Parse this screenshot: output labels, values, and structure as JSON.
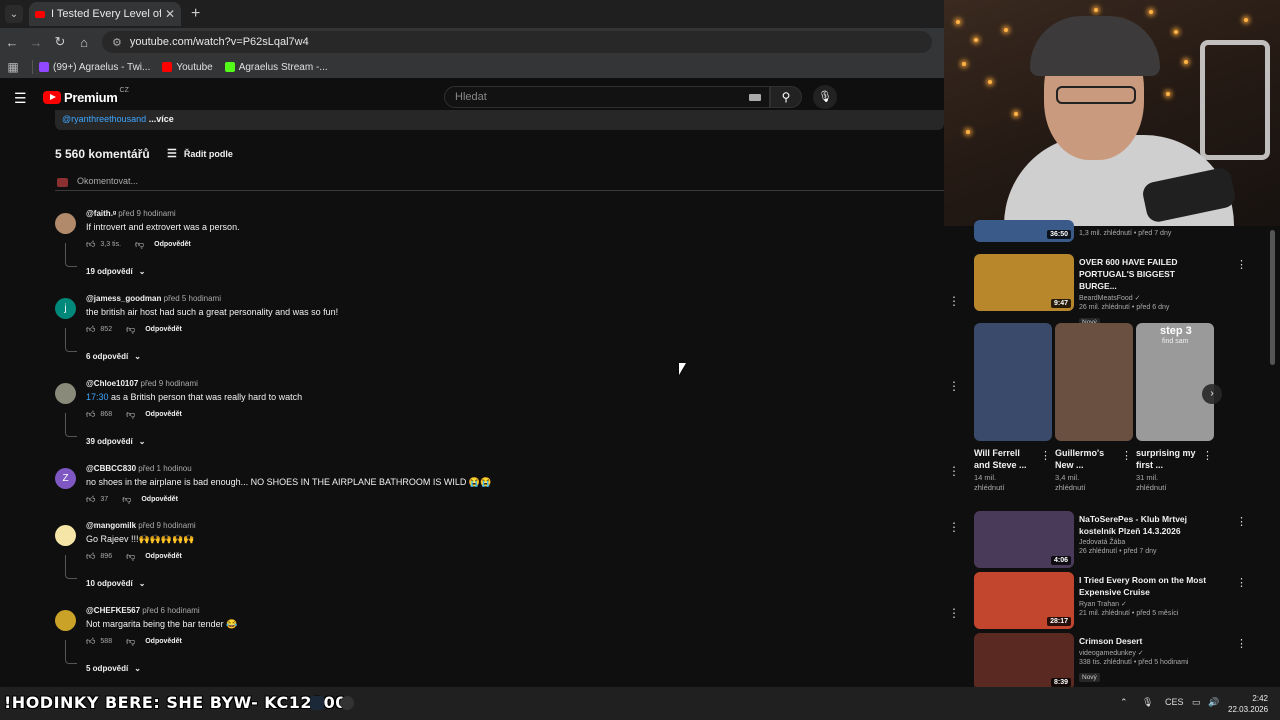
{
  "browser": {
    "tab_title": "I Tested Every Level of Airplane",
    "url": "youtube.com/watch?v=P62sLqal7w4",
    "bookmarks": [
      {
        "label": "(99+) Agraelus - Twi...",
        "color": "#9146ff"
      },
      {
        "label": "Youtube",
        "color": "#ff0000"
      },
      {
        "label": "Agraelus Stream -...",
        "color": "#53fc18"
      }
    ]
  },
  "header": {
    "logo_text": "Premium",
    "logo_country": "CZ",
    "search_placeholder": "Hledat"
  },
  "description": {
    "handle": "@ryanthreethousand",
    "more": "...více"
  },
  "comments_section": {
    "count_label": "5 560 komentářů",
    "sort_label": "Řadit podle",
    "add_placeholder": "Okomentovat..."
  },
  "comments": [
    {
      "author": "@faith.ᵍ",
      "time": "před 9 hodinami",
      "text": "If introvert and extrovert was a person.",
      "timestamp": "",
      "likes": "3,3 tis.",
      "reply": "Odpovědět",
      "replies": "19 odpovědí",
      "avatar_color": "#b08a6a",
      "avatar_letter": ""
    },
    {
      "author": "@jamess_goodman",
      "time": "před 5 hodinami",
      "text": "the british air host had such a great personality and was so fun!",
      "timestamp": "",
      "likes": "852",
      "reply": "Odpovědět",
      "replies": "6 odpovědí",
      "avatar_color": "#00897b",
      "avatar_letter": "j"
    },
    {
      "author": "@Chloe10107",
      "time": "před 9 hodinami",
      "text": "as a British person that was really hard to watch",
      "timestamp": "17:30",
      "likes": "868",
      "reply": "Odpovědět",
      "replies": "39 odpovědí",
      "avatar_color": "#8a8a7a",
      "avatar_letter": ""
    },
    {
      "author": "@CBBCC830",
      "time": "před 1 hodinou",
      "text": "no shoes in the airplane is bad enough... NO SHOES IN THE AIRPLANE BATHROOM IS WILD 😭😭",
      "timestamp": "",
      "likes": "37",
      "reply": "Odpovědět",
      "replies": "",
      "avatar_color": "#7e57c2",
      "avatar_letter": "Z"
    },
    {
      "author": "@mangomilk",
      "time": "před 9 hodinami",
      "text": "Go Rajeev !!!🙌🙌🙌🙌🙌",
      "timestamp": "",
      "likes": "896",
      "reply": "Odpovědět",
      "replies": "10 odpovědí",
      "avatar_color": "#f5e6a8",
      "avatar_letter": ""
    },
    {
      "author": "@CHEFKE567",
      "time": "před 6 hodinami",
      "text": "Not margarita being the bar tender 😂",
      "timestamp": "",
      "likes": "588",
      "reply": "Odpovědět",
      "replies": "5 odpovědí",
      "avatar_color": "#c9a227",
      "avatar_letter": ""
    }
  ],
  "sidebar": {
    "top_partial": {
      "duration": "36:50",
      "stats": "1,3 mil. zhlédnutí • před 7 dny"
    },
    "videos": [
      {
        "title": "OVER 600 HAVE FAILED PORTUGAL'S BIGGEST BURGE...",
        "channel": "BeardMeatsFood ✓",
        "stats": "26 mil. zhlédnutí • před 6 dny",
        "badge": "Nový",
        "duration": "9:47",
        "thumb_color": "#b8862b"
      },
      {
        "title": "NaToSerePes - Klub Mrtvej kostelník Plzeň 14.3.2026",
        "channel": "Jedovatá Žába",
        "stats": "26 zhlédnutí • před 7 dny",
        "badge": "",
        "duration": "4:06",
        "thumb_color": "#4a3a5a"
      },
      {
        "title": "I Tried Every Room on the Most Expensive Cruise",
        "channel": "Ryan Trahan ✓",
        "stats": "21 mil. zhlédnutí • před 5 měsíci",
        "badge": "",
        "duration": "28:17",
        "thumb_color": "#c2452d"
      },
      {
        "title": "Crimson Desert",
        "channel": "videogamedunkey ✓",
        "stats": "338 tis. zhlédnutí • před 5 hodinami",
        "badge": "Nový",
        "duration": "8:39",
        "thumb_color": "#5a2a22"
      }
    ],
    "shorts": [
      {
        "title": "Will Ferrell and Steve ...",
        "views": "14 mil. zhlédnutí",
        "thumb_color": "#3a4a6a"
      },
      {
        "title": "Guillermo's New ...",
        "views": "3,4 mil. zhlédnutí",
        "thumb_color": "#6a5040"
      },
      {
        "title": "surprising my first ...",
        "views": "31 mil. zhlédnutí",
        "thumb_color": "#9a9a9a",
        "overlay_title": "step 3",
        "overlay_sub": "find sam"
      }
    ]
  },
  "taskbar": {
    "overlay_text": "!HODINKY BERE: SHE BYW- KC12900",
    "lang": "CES",
    "time": "2:42",
    "date": "22.03.2026"
  }
}
